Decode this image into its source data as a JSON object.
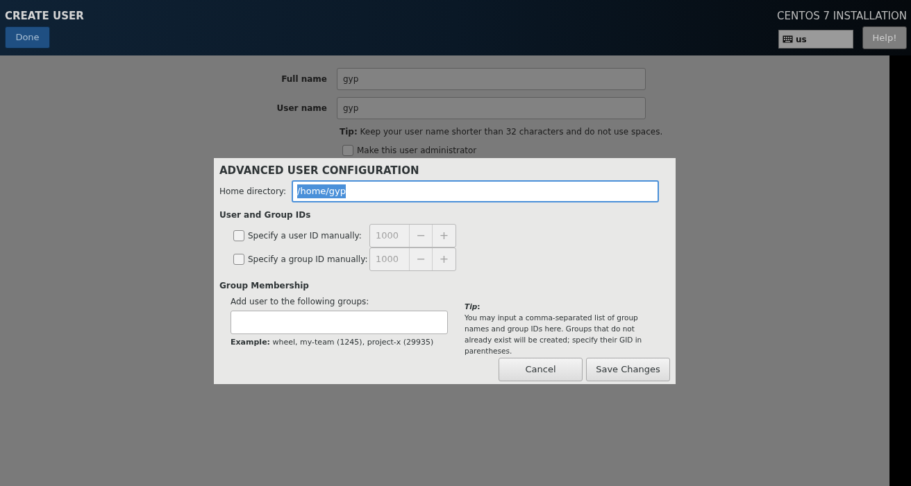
{
  "header": {
    "title": "CREATE USER",
    "done_button": "Done",
    "product": "CENTOS 7 INSTALLATION",
    "keyboard_layout": "us",
    "help_button": "Help!"
  },
  "form": {
    "fields": [
      {
        "label": "Full name",
        "value": "gyp"
      },
      {
        "label": "User name",
        "value": "gyp"
      }
    ],
    "tip": "**Tip:** Keep your user name shorter than 32 characters and do not use spaces.",
    "admin_checkbox": {
      "label": "Make this user administrator",
      "checked": false
    }
  },
  "dialog": {
    "title": "ADVANCED USER CONFIGURATION",
    "home_label": "Home directory:",
    "home_value": "/home/gyp",
    "home_selected": true,
    "ids_heading": "User and Group IDs",
    "ids": [
      {
        "label": "Specify a user ID manually:",
        "checked": false,
        "value": "1000",
        "minus": "−",
        "plus": "+"
      },
      {
        "label": "Specify a group ID manually:",
        "checked": false,
        "value": "1000",
        "minus": "−",
        "plus": "+"
      }
    ],
    "groups_heading": "Group Membership",
    "groups_label": "Add user to the following groups:",
    "example": "**Example:** wheel, my-team (1245), project-x (29935)",
    "tip_label": "*Tip*:",
    "tip_text": "You may input a comma-separated list of group names and group IDs here. Groups that do not already exist will be created; specify their GID in parentheses.",
    "buttons": [
      "Cancel",
      "Save Changes"
    ]
  }
}
